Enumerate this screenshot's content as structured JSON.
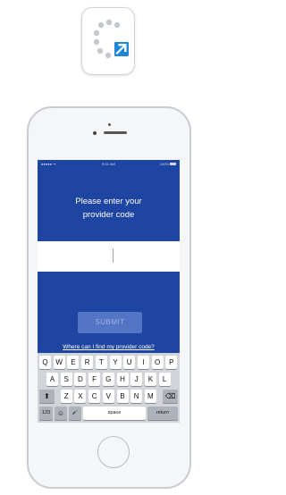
{
  "app_icon": {
    "name": "loading-app-icon",
    "colors": {
      "dots": "#c4c9cf",
      "arrow_bg": "#1e88d8",
      "arrow": "#ffffff"
    }
  },
  "status_bar": {
    "carrier": "●●●●● ᯤ",
    "time": "9:41 AM",
    "battery": "100%"
  },
  "screen": {
    "prompt_line1": "Please enter your",
    "prompt_line2": "provider code",
    "code_input_value": "",
    "submit_label": "SUBMIT",
    "help_link": "Where can I find my provider code?"
  },
  "keyboard": {
    "row1": [
      "Q",
      "W",
      "E",
      "R",
      "T",
      "Y",
      "U",
      "I",
      "O",
      "P"
    ],
    "row2": [
      "A",
      "S",
      "D",
      "F",
      "G",
      "H",
      "J",
      "K",
      "L"
    ],
    "row3": [
      "Z",
      "X",
      "C",
      "V",
      "B",
      "N",
      "M"
    ],
    "shift": "⬆",
    "delete": "⌫",
    "numbers": "123",
    "emoji": "☺",
    "mic": "🎤",
    "space": "space",
    "return": "return"
  }
}
